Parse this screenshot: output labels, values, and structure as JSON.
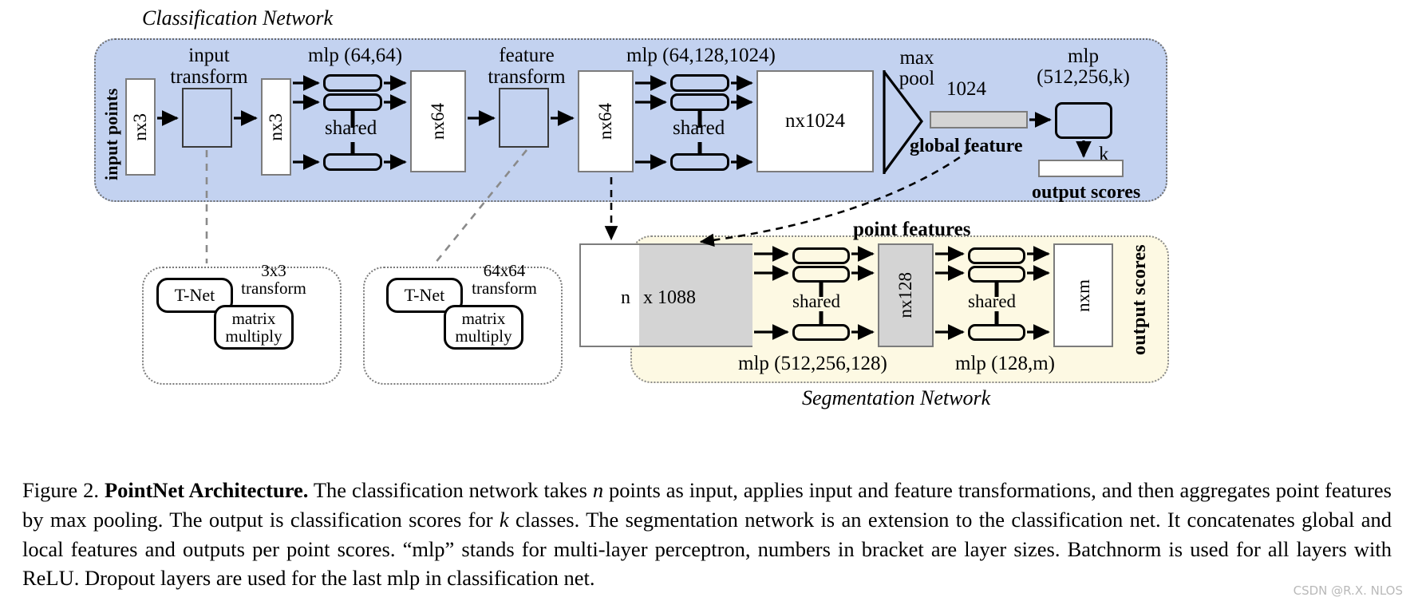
{
  "figure": {
    "classification_network_title": "Classification Network",
    "segmentation_network_title": "Segmentation Network"
  },
  "classification": {
    "input_points_label": "input points",
    "input_tensor_label": "nx3",
    "input_transform_label_line1": "input",
    "input_transform_label_line2": "transform",
    "post_transform_tensor_label": "nx3",
    "mlp1_label": "mlp (64,64)",
    "shared1_label": "shared",
    "nx64_a_label": "nx64",
    "feature_transform_label_line1": "feature",
    "feature_transform_label_line2": "transform",
    "nx64_b_label": "nx64",
    "mlp2_label": "mlp (64,128,1024)",
    "shared2_label": "shared",
    "nx1024_label": "nx1024",
    "maxpool_label_line1": "max",
    "maxpool_label_line2": "pool",
    "global_feature_size": "1024",
    "global_feature_label": "global feature",
    "mlp3_label_line1": "mlp",
    "mlp3_label_line2": "(512,256,k)",
    "k_label": "k",
    "output_scores_label": "output scores"
  },
  "tnet_blocks": [
    {
      "name": "input-transform-detail",
      "tnet_label": "T-Net",
      "transform_label_line1": "3x3",
      "transform_label_line2": "transform",
      "matrix_label_line1": "matrix",
      "matrix_label_line2": "multiply"
    },
    {
      "name": "feature-transform-detail",
      "tnet_label": "T-Net",
      "transform_label_line1": "64x64",
      "transform_label_line2": "transform",
      "matrix_label_line1": "matrix",
      "matrix_label_line2": "multiply"
    }
  ],
  "segmentation": {
    "point_features_label": "point features",
    "concat_n_label": "n",
    "concat_dim_label": "x 1088",
    "shared1_label": "shared",
    "mlp1_label": "mlp (512,256,128)",
    "nx128_label": "nx128",
    "shared2_label": "shared",
    "mlp2_label": "mlp (128,m)",
    "nxm_label": "nxm",
    "output_scores_label": "output scores"
  },
  "caption": {
    "figure_number": "Figure 2.",
    "bold_title": "PointNet Architecture.",
    "part1": " The classification network takes ",
    "italic_n_1": "n",
    "part2": " points as input, applies input and feature transformations, and then aggregates point features by max pooling. The output is classification scores for ",
    "italic_k": "k",
    "part3": " classes. The segmentation network is an extension to the classification net. It concatenates global and local features and outputs per point scores. “mlp” stands for multi-layer perceptron, numbers in bracket are layer sizes. Batchnorm is used for all layers with ReLU. Dropout layers are used for the last mlp in classification net."
  },
  "watermark": {
    "text": "CSDN @R.X. NLOS"
  },
  "colors": {
    "classification_panel": "#c3d2f0",
    "segmentation_panel": "#fdf9e3",
    "global_feature_fill": "#d4d4d4",
    "point_feature_fill": "#d4d4d4",
    "box_stroke": "#7c7c7c",
    "arrow": "#000000"
  }
}
